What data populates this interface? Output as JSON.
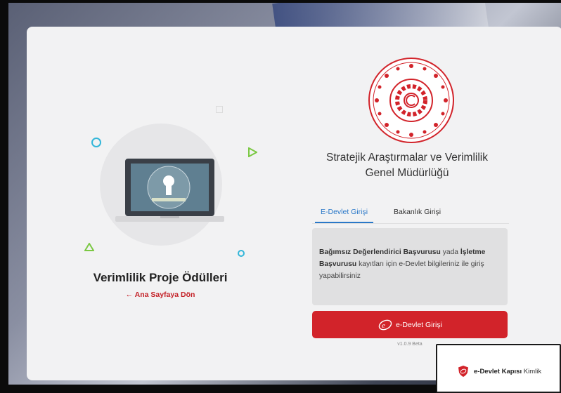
{
  "left_panel": {
    "title": "Verimlilik Proje Ödülleri",
    "back_link": "← Ana Sayfaya Dön"
  },
  "right_panel": {
    "org_title_line1": "Stratejik Araştırmalar ve Verimlilik",
    "org_title_line2": "Genel Müdürlüğü",
    "tabs": [
      {
        "label": "E-Devlet Girişi",
        "active": true
      },
      {
        "label": "Bakanlık Girişi",
        "active": false
      }
    ],
    "info": {
      "bold1": "Bağımsız Değerlendirici Başvurusu",
      "text1": " yada ",
      "bold2": "İşletme Başvurusu",
      "text2": " kayıtları için e-Devlet bilgileriniz ile giriş yapabilirsiniz"
    },
    "login_button": {
      "icon_text": "e",
      "label": "e-Devlet Girişi"
    },
    "version": "v1.0.9 Beta"
  },
  "popup": {
    "bold": "e-Devlet Kapısı",
    "text": " Kimlik"
  },
  "colors": {
    "accent_red": "#d2232a",
    "tab_blue": "#2a78c8",
    "decor_cyan": "#33b6d9",
    "decor_green": "#7bc843"
  }
}
